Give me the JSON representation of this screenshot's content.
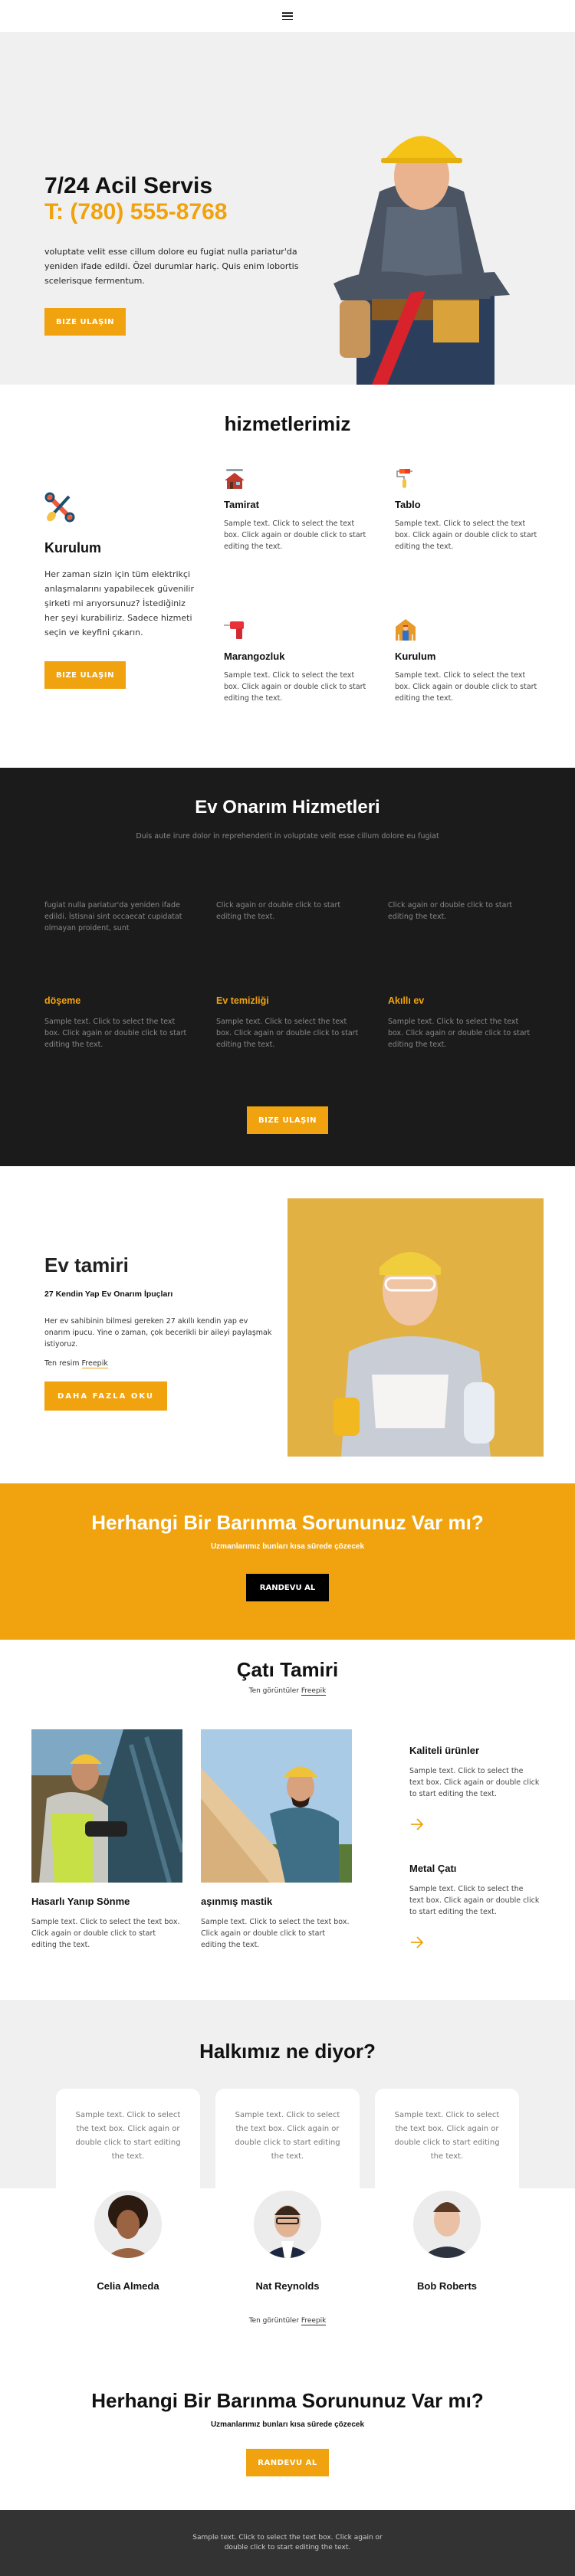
{
  "header": {
    "menu_icon": "hamburger-menu-icon"
  },
  "hero": {
    "title": "7/24 Acil Servis",
    "phone": "T: (780) 555-8768",
    "text": "voluptate velit esse cillum dolore eu fugiat nulla pariatur'da yeniden ifade edildi. Özel durumlar hariç. Quis enim lobortis scelerisque fermentum.",
    "button": "BIZE ULAŞIN",
    "image": "construction-worker-photo"
  },
  "services": {
    "title": "hizmetlerimiz",
    "main": {
      "icon": "tools-icon",
      "title": "Kurulum",
      "text": "Her zaman sizin için tüm elektrikçi anlaşmalarını yapabilecek güvenilir şirketi mi arıyorsunuz? İstediğiniz her şeyi kurabiliriz. Sadece hizmeti seçin ve keyfini çıkarın.",
      "button": "BIZE ULAŞIN"
    },
    "items": [
      {
        "icon": "house-repair-icon",
        "title": "Tamirat",
        "text": "Sample text. Click to select the text box. Click again or double click to start editing the text."
      },
      {
        "icon": "paint-roller-icon",
        "title": "Tablo",
        "text": "Sample text. Click to select the text box. Click again or double click to start editing the text."
      },
      {
        "icon": "drill-icon",
        "title": "Marangozluk",
        "text": "Sample text. Click to select the text box. Click again or double click to start editing the text."
      },
      {
        "icon": "worker-house-icon",
        "title": "Kurulum",
        "text": "Sample text. Click to select the text box. Click again or double click to start editing the text."
      }
    ]
  },
  "home_repair": {
    "title": "Ev Onarım Hizmetleri",
    "subtitle": "Duis aute irure dolor in reprehenderit in voluptate velit esse cillum dolore eu fugiat",
    "top_columns": [
      {
        "text": "fugiat nulla pariatur'da yeniden ifade edildi. İstisnai sint occaecat cupidatat olmayan proident, sunt"
      },
      {
        "text": "Click again or double click to start editing the text."
      },
      {
        "text": "Click again or double click to start editing the text."
      }
    ],
    "columns": [
      {
        "title": "döşeme",
        "text": "Sample text. Click to select the text box. Click again or double click to start editing the text."
      },
      {
        "title": "Ev temizliği",
        "text": "Sample text. Click to select the text box. Click again or double click to start editing the text."
      },
      {
        "title": "Akıllı ev",
        "text": "Sample text. Click to select the text box. Click again or double click to start editing the text."
      }
    ],
    "button": "BIZE ULAŞIN"
  },
  "ev_tamiri": {
    "title": "Ev tamiri",
    "subtitle": "27 Kendin Yap Ev Onarım İpuçları",
    "text": "Her ev sahibinin bilmesi gereken 27 akıllı kendin yap ev onarım ipucu. Yine o zaman, çok becerikli bir aileyi paylaşmak istiyoruz.",
    "credit_prefix": "Ten resim",
    "credit_link": "Freepik",
    "button": "DAHA FAZLA OKU",
    "image": "woman-worker-photo"
  },
  "cta_yellow": {
    "title": "Herhangi Bir Barınma Sorununuz Var mı?",
    "subtitle": "Uzmanlarımız bunları kısa sürede çözecek",
    "button": "RANDEVU AL"
  },
  "roof": {
    "title": "Çatı Tamiri",
    "credit_prefix": "Ten görüntüler",
    "credit_link": "Freepik",
    "cards": [
      {
        "image": "roof-worker-drill-photo",
        "title": "Hasarlı Yanıp Sönme",
        "text": "Sample text. Click to select the text box. Click again or double click to start editing the text."
      },
      {
        "image": "roof-worker-hammer-photo",
        "title": "aşınmış mastik",
        "text": "Sample text. Click to select the text box. Click again or double click to start editing the text."
      }
    ],
    "side": [
      {
        "title": "Kaliteli ürünler",
        "text": "Sample text. Click to select the text box. Click again or double click to start editing the text.",
        "icon": "arrow-right-icon"
      },
      {
        "title": "Metal Çatı",
        "text": "Sample text. Click to select the text box. Click again or double click to start editing the text.",
        "icon": "arrow-right-icon"
      }
    ]
  },
  "testimonials": {
    "title": "Halkımız ne diyor?",
    "items": [
      {
        "text": "Sample text. Click to select the text box. Click again or double click to start editing the text.",
        "name": "Celia Almeda"
      },
      {
        "text": "Sample text. Click to select the text box. Click again or double click to start editing the text.",
        "name": "Nat Reynolds"
      },
      {
        "text": "Sample text. Click to select the text box. Click again or double click to start editing the text.",
        "name": "Bob Roberts"
      }
    ],
    "credit_prefix": "Ten görüntüler",
    "credit_link": "Freepik"
  },
  "cta_white": {
    "title": "Herhangi Bir Barınma Sorununuz Var mı?",
    "subtitle": "Uzmanlarımız bunları kısa sürede çözecek",
    "button": "RANDEVU AL"
  },
  "footer": {
    "text": "Sample text. Click to select the text box. Click again or double click to start editing the text."
  },
  "colors": {
    "accent": "#f0a30e",
    "dark_bg": "#1b1b1b",
    "footer_bg": "#333333",
    "light_bg": "#f0f0f0"
  }
}
